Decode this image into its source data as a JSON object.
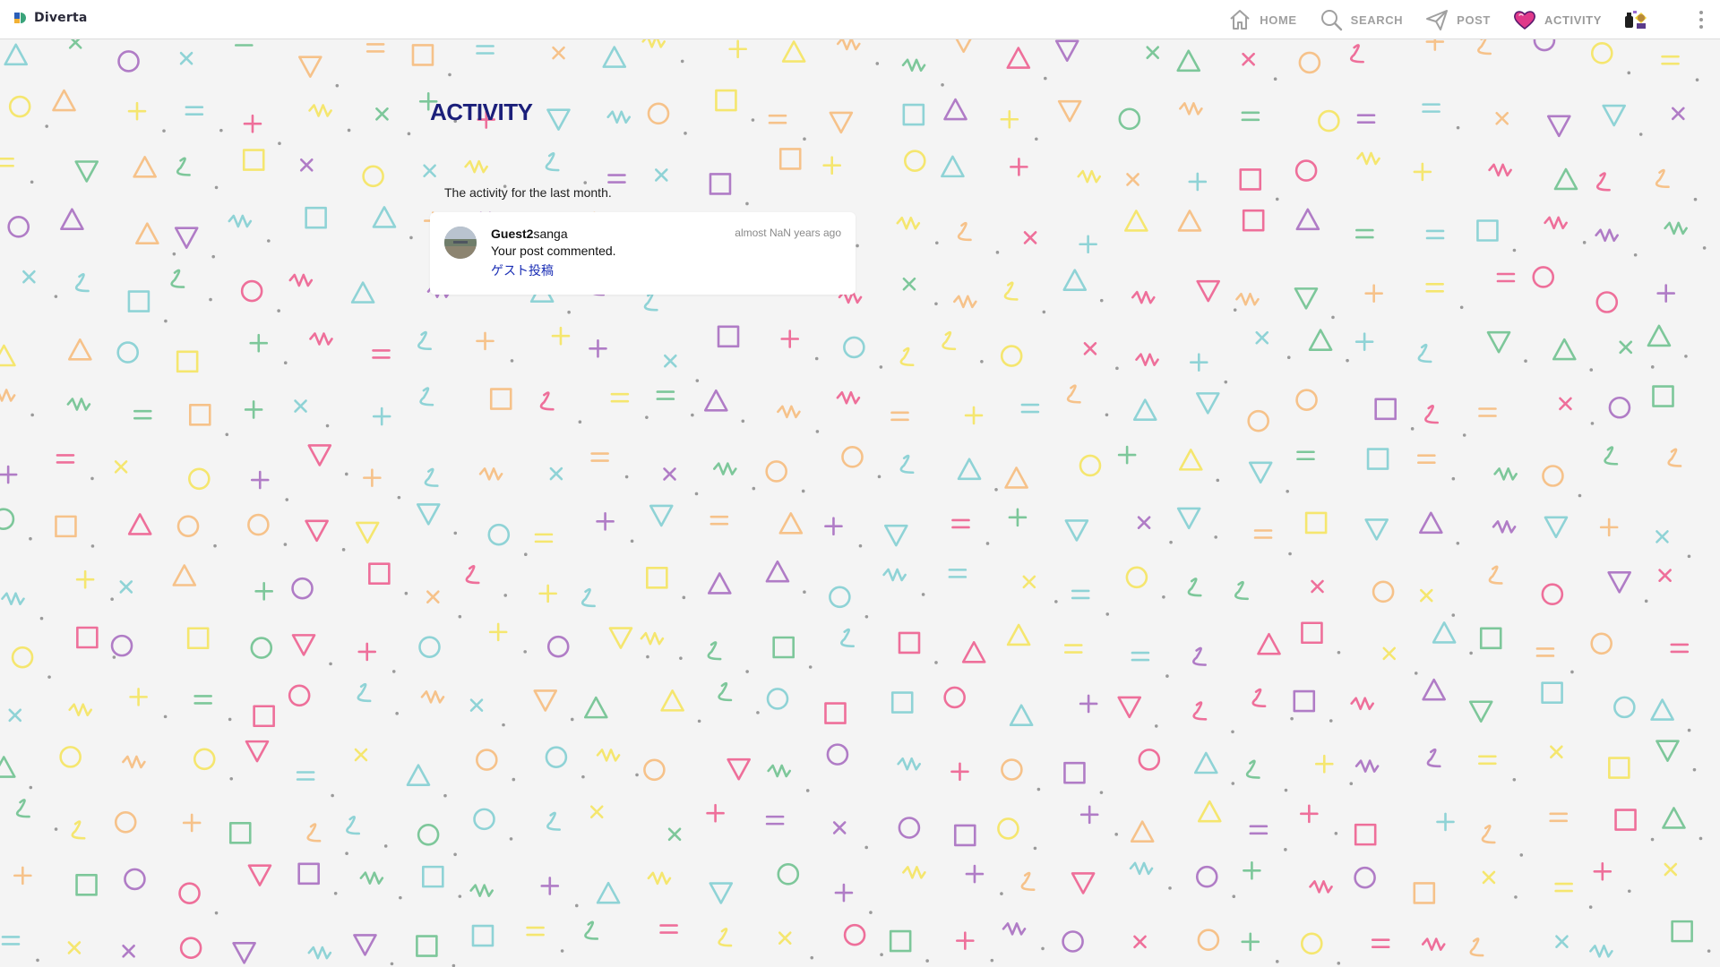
{
  "app": {
    "name": "Diverta"
  },
  "nav": {
    "home": "HOME",
    "search": "SEARCH",
    "post": "POST",
    "activity": "ACTIVITY"
  },
  "page": {
    "title": "ACTIVITY",
    "subtitle": "The activity for the last month."
  },
  "activities": [
    {
      "user_bold": "Guest2",
      "user_rest": "sanga",
      "message": "Your post commented.",
      "post_title": "ゲスト投稿",
      "time": "almost NaN years ago"
    }
  ],
  "colors": {
    "title": "#1b1f7a",
    "link": "#1b2fb5",
    "pattern": [
      "#8fd3d6",
      "#f6c28a",
      "#f5e66f",
      "#b07cc6",
      "#ee6f9a",
      "#7dc79a"
    ]
  }
}
